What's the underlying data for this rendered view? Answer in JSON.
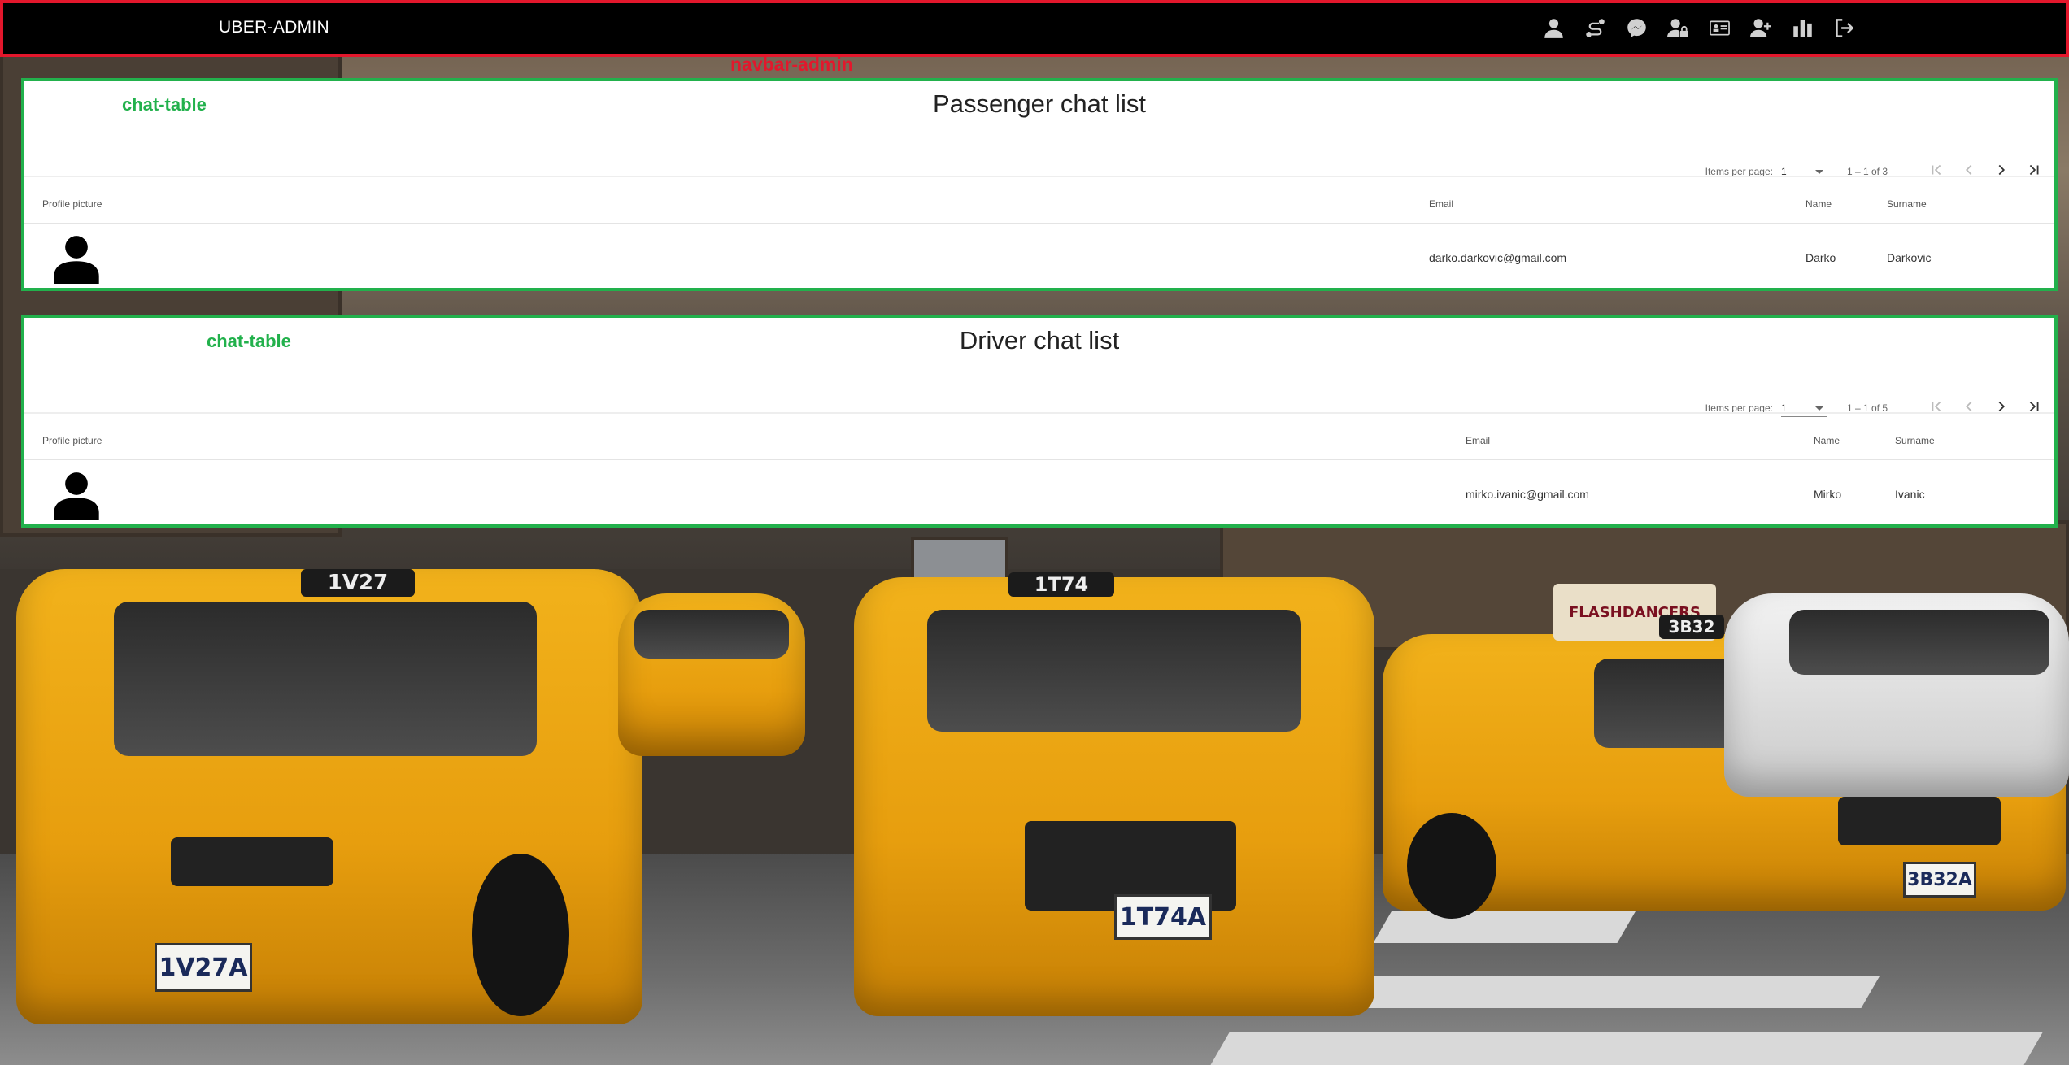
{
  "navbar": {
    "brand": "UBER-ADMIN",
    "caption": "navbar-admin",
    "icons": [
      "user-icon",
      "route-icon",
      "messenger-icon",
      "user-lock-icon",
      "id-card-icon",
      "user-plus-icon",
      "bar-chart-icon",
      "logout-icon"
    ]
  },
  "passenger_table": {
    "caption": "chat-table",
    "title": "Passenger chat list",
    "paginator": {
      "items_per_page_label": "Items per page:",
      "items_per_page_value": "1",
      "range": "1 – 1 of 3"
    },
    "columns": {
      "profile": "Profile picture",
      "email": "Email",
      "name": "Name",
      "surname": "Surname"
    },
    "rows": [
      {
        "email": "darko.darkovic@gmail.com",
        "name": "Darko",
        "surname": "Darkovic"
      }
    ]
  },
  "driver_table": {
    "caption": "chat-table",
    "title": "Driver chat list",
    "paginator": {
      "items_per_page_label": "Items per page:",
      "items_per_page_value": "1",
      "range": "1 – 1 of 5"
    },
    "columns": {
      "profile": "Profile picture",
      "email": "Email",
      "name": "Name",
      "surname": "Surname"
    },
    "rows": [
      {
        "email": "mirko.ivanic@gmail.com",
        "name": "Mirko",
        "surname": "Ivanic"
      }
    ]
  },
  "background": {
    "plates": [
      "1V27",
      "1V27A",
      "1T74",
      "1T74A",
      "3B32",
      "3B32A"
    ],
    "sign": "FLASHDANCERS"
  },
  "colors": {
    "navbar_border": "#e3172c",
    "table_border": "#22b14c",
    "taxi_yellow": "#f2b21b"
  }
}
